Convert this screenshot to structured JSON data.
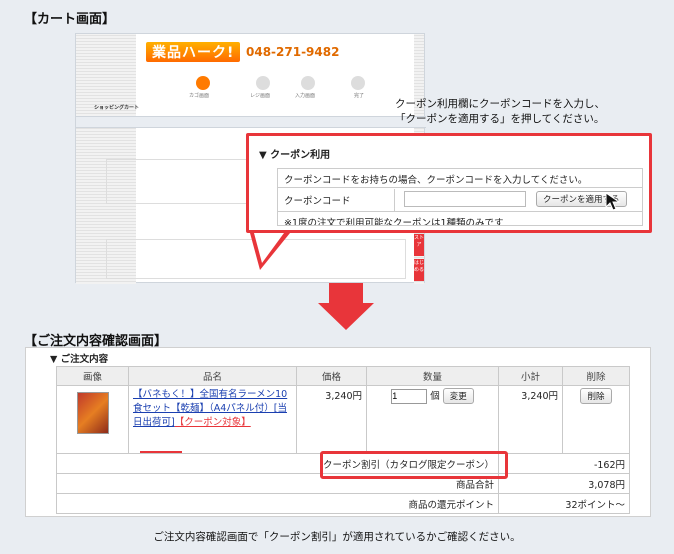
{
  "cart_heading": "【カート画面】",
  "shot": {
    "logo_text": "業品ハーク!",
    "phone": "048-271-9482",
    "steps": [
      "カゴ画面",
      "レジ画面",
      "入力画面",
      "完了"
    ],
    "page_label": "ショッピングカート",
    "side_tabs": [
      "ストア",
      "はじめる"
    ]
  },
  "callout": {
    "line1": "クーポン利用欄にクーポンコードを入力し、",
    "line2": "「クーポンを適用する」を押してください。"
  },
  "coupon_panel": {
    "title": "▼ クーポン利用",
    "instruction": "クーポンコードをお持ちの場合、クーポンコードを入力してください。",
    "code_label": "クーポンコード",
    "code_value": "",
    "apply_button": "クーポンを適用する",
    "note": "※1度の注文で利用可能なクーポンは1種類のみです"
  },
  "confirm_heading": "【ご注文内容確認画面】",
  "order": {
    "section_title": "▼ ご注文内容",
    "headers": [
      "画像",
      "品名",
      "価格",
      "数量",
      "小計",
      "削除"
    ],
    "product_name_1": "【バネもく！】全国有名ラーメン10食セット【乾麺】（A4パネル付）[当日出荷可]",
    "product_name_2": "【クーポン対象】",
    "price": "3,240円",
    "qty": "1",
    "qty_unit": "個",
    "change_button": "変更",
    "subtotal": "3,240円",
    "delete_button": "削除",
    "rows": [
      {
        "label": "クーポン割引（カタログ限定クーポン）",
        "value": "-162円"
      },
      {
        "label": "商品合計",
        "value": "3,078円"
      },
      {
        "label": "商品の還元ポイント",
        "value": "32ポイント〜"
      }
    ]
  },
  "footer_note": "ご注文内容確認画面で「クーポン割引」が適用されているかご確認ください。",
  "colors": {
    "accent_red": "#e8353a",
    "link_blue": "#1a3fb0",
    "brand_orange": "#ff7a00"
  }
}
